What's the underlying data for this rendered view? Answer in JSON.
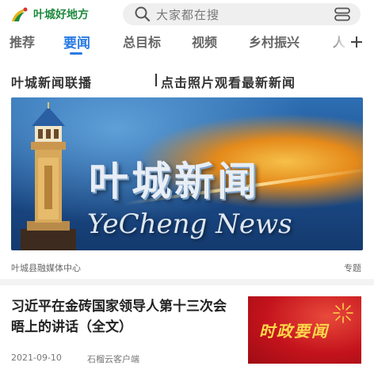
{
  "header": {
    "app_name": "叶城好地方",
    "search_placeholder": "大家都在搜",
    "brand_color": "#1e8a3e"
  },
  "tabs": [
    {
      "label": "推荐",
      "active": false
    },
    {
      "label": "要闻",
      "active": true
    },
    {
      "label": "总目标",
      "active": false
    },
    {
      "label": "视频",
      "active": false
    },
    {
      "label": "乡村振兴",
      "active": false
    },
    {
      "label": "人",
      "active": false
    }
  ],
  "accent_color": "#2a7be4",
  "headline": {
    "left": "叶城新闻联播",
    "right": "点击照片观看最新新闻"
  },
  "banner": {
    "title": "叶城新闻",
    "subtitle": "YeCheng News",
    "source": "叶城县融媒体中心",
    "tag": "专题"
  },
  "news": {
    "title": "习近平在金砖国家领导人第十三次会晤上的讲话（全文）",
    "date": "2021-09-10",
    "source": "石榴云客户端",
    "thumb_text": "时政要闻"
  },
  "icons": [
    "logo-icon",
    "search-icon",
    "menu-icon",
    "add-icon"
  ]
}
